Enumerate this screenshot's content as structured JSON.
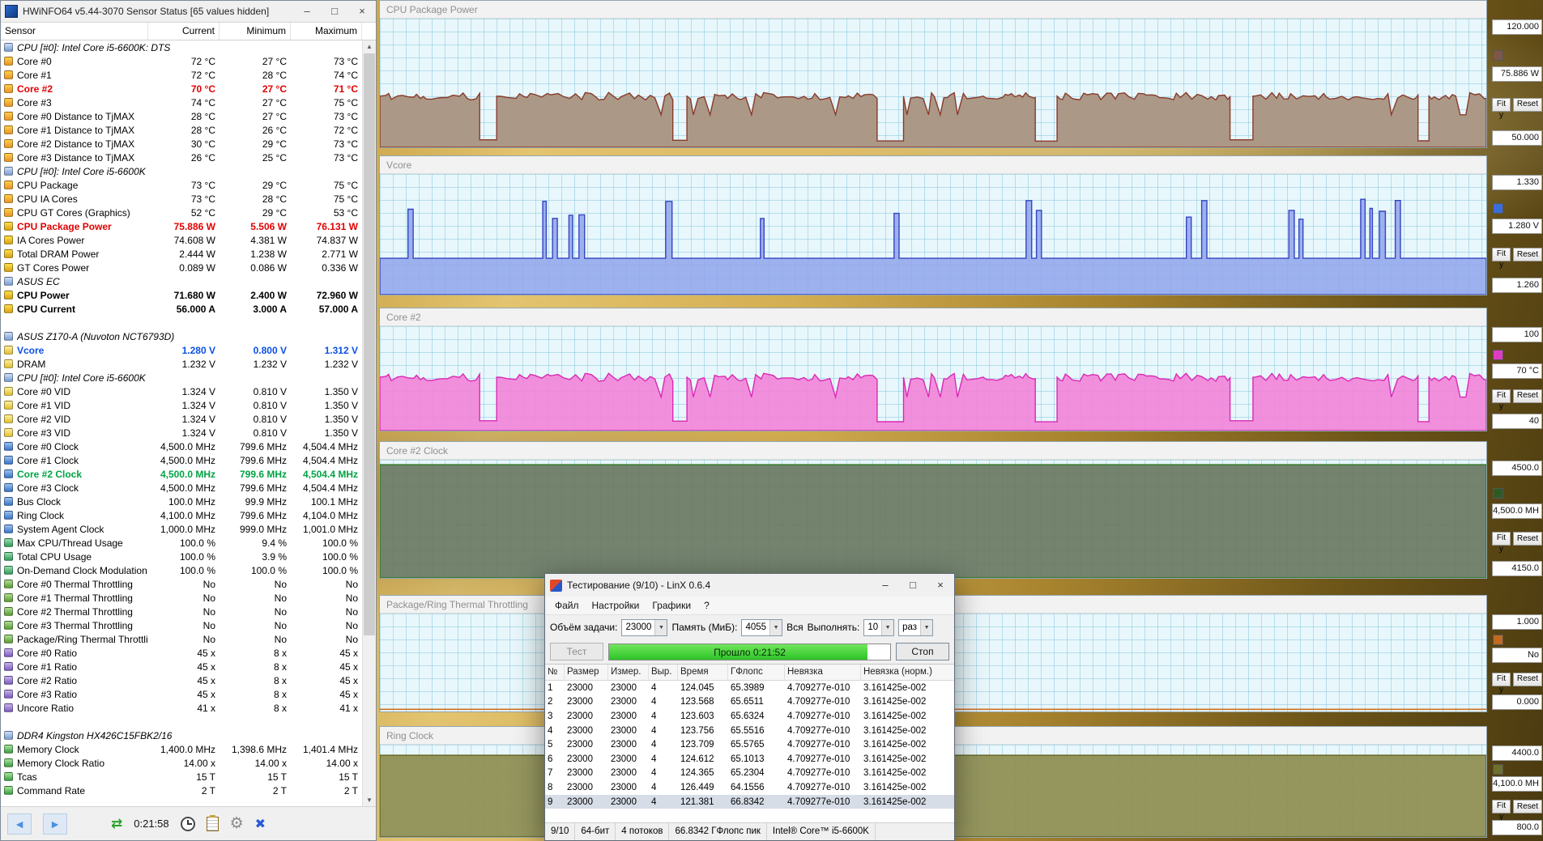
{
  "chrome": {
    "minimize": "–",
    "maximize": "□",
    "close": "×"
  },
  "hwinfo": {
    "title": "HWiNFO64 v5.44-3070 Sensor Status [65 values hidden]",
    "columns": [
      "Sensor",
      "Current",
      "Minimum",
      "Maximum"
    ],
    "toolbar": {
      "time": "0:21:58"
    },
    "rows": [
      {
        "t": "g",
        "l": "CPU [#0]: Intel Core i5-6600K: DTS"
      },
      {
        "t": "v",
        "i": "temp",
        "l": "Core #0",
        "c": "72 °C",
        "m": "27 °C",
        "x": "73 °C"
      },
      {
        "t": "v",
        "i": "temp",
        "l": "Core #1",
        "c": "72 °C",
        "m": "28 °C",
        "x": "74 °C"
      },
      {
        "t": "v",
        "i": "temp",
        "s": "red",
        "l": "Core #2",
        "c": "70 °C",
        "m": "27 °C",
        "x": "71 °C"
      },
      {
        "t": "v",
        "i": "temp",
        "l": "Core #3",
        "c": "74 °C",
        "m": "27 °C",
        "x": "75 °C"
      },
      {
        "t": "v",
        "i": "temp",
        "l": "Core #0 Distance to TjMAX",
        "c": "28 °C",
        "m": "27 °C",
        "x": "73 °C"
      },
      {
        "t": "v",
        "i": "temp",
        "l": "Core #1 Distance to TjMAX",
        "c": "28 °C",
        "m": "26 °C",
        "x": "72 °C"
      },
      {
        "t": "v",
        "i": "temp",
        "l": "Core #2 Distance to TjMAX",
        "c": "30 °C",
        "m": "29 °C",
        "x": "73 °C"
      },
      {
        "t": "v",
        "i": "temp",
        "l": "Core #3 Distance to TjMAX",
        "c": "26 °C",
        "m": "25 °C",
        "x": "73 °C"
      },
      {
        "t": "g",
        "l": "CPU [#0]: Intel Core i5-6600K"
      },
      {
        "t": "v",
        "i": "temp",
        "l": "CPU Package",
        "c": "73 °C",
        "m": "29 °C",
        "x": "75 °C"
      },
      {
        "t": "v",
        "i": "temp",
        "l": "CPU IA Cores",
        "c": "73 °C",
        "m": "28 °C",
        "x": "75 °C"
      },
      {
        "t": "v",
        "i": "temp",
        "l": "CPU GT Cores (Graphics)",
        "c": "52 °C",
        "m": "29 °C",
        "x": "53 °C"
      },
      {
        "t": "v",
        "i": "power",
        "s": "red",
        "l": "CPU Package Power",
        "c": "75.886 W",
        "m": "5.506 W",
        "x": "76.131 W"
      },
      {
        "t": "v",
        "i": "power",
        "l": "IA Cores Power",
        "c": "74.608 W",
        "m": "4.381 W",
        "x": "74.837 W"
      },
      {
        "t": "v",
        "i": "power",
        "l": "Total DRAM Power",
        "c": "2.444 W",
        "m": "1.238 W",
        "x": "2.771 W"
      },
      {
        "t": "v",
        "i": "power",
        "l": "GT Cores Power",
        "c": "0.089 W",
        "m": "0.086 W",
        "x": "0.336 W"
      },
      {
        "t": "g",
        "l": "ASUS EC"
      },
      {
        "t": "v",
        "i": "power",
        "s": "bold",
        "l": "CPU Power",
        "c": "71.680 W",
        "m": "2.400 W",
        "x": "72.960 W"
      },
      {
        "t": "v",
        "i": "power",
        "s": "bold",
        "l": "CPU Current",
        "c": "56.000 A",
        "m": "3.000 A",
        "x": "57.000 A"
      },
      {
        "t": "s"
      },
      {
        "t": "g",
        "l": "ASUS Z170-A (Nuvoton NCT6793D)"
      },
      {
        "t": "v",
        "i": "volt",
        "s": "blue",
        "l": "Vcore",
        "c": "1.280 V",
        "m": "0.800 V",
        "x": "1.312 V"
      },
      {
        "t": "v",
        "i": "volt",
        "l": "DRAM",
        "c": "1.232 V",
        "m": "1.232 V",
        "x": "1.232 V"
      },
      {
        "t": "g",
        "l": "CPU [#0]: Intel Core i5-6600K"
      },
      {
        "t": "v",
        "i": "volt",
        "l": "Core #0 VID",
        "c": "1.324 V",
        "m": "0.810 V",
        "x": "1.350 V"
      },
      {
        "t": "v",
        "i": "volt",
        "l": "Core #1 VID",
        "c": "1.324 V",
        "m": "0.810 V",
        "x": "1.350 V"
      },
      {
        "t": "v",
        "i": "volt",
        "l": "Core #2 VID",
        "c": "1.324 V",
        "m": "0.810 V",
        "x": "1.350 V"
      },
      {
        "t": "v",
        "i": "volt",
        "l": "Core #3 VID",
        "c": "1.324 V",
        "m": "0.810 V",
        "x": "1.350 V"
      },
      {
        "t": "v",
        "i": "clock",
        "l": "Core #0 Clock",
        "c": "4,500.0 MHz",
        "m": "799.6 MHz",
        "x": "4,504.4 MHz"
      },
      {
        "t": "v",
        "i": "clock",
        "l": "Core #1 Clock",
        "c": "4,500.0 MHz",
        "m": "799.6 MHz",
        "x": "4,504.4 MHz"
      },
      {
        "t": "v",
        "i": "clock",
        "s": "green",
        "l": "Core #2 Clock",
        "c": "4,500.0 MHz",
        "m": "799.6 MHz",
        "x": "4,504.4 MHz"
      },
      {
        "t": "v",
        "i": "clock",
        "l": "Core #3 Clock",
        "c": "4,500.0 MHz",
        "m": "799.6 MHz",
        "x": "4,504.4 MHz"
      },
      {
        "t": "v",
        "i": "clock",
        "l": "Bus Clock",
        "c": "100.0 MHz",
        "m": "99.9 MHz",
        "x": "100.1 MHz"
      },
      {
        "t": "v",
        "i": "clock",
        "l": "Ring Clock",
        "c": "4,100.0 MHz",
        "m": "799.6 MHz",
        "x": "4,104.0 MHz"
      },
      {
        "t": "v",
        "i": "clock",
        "l": "System Agent Clock",
        "c": "1,000.0 MHz",
        "m": "999.0 MHz",
        "x": "1,001.0 MHz"
      },
      {
        "t": "v",
        "i": "usage",
        "l": "Max CPU/Thread Usage",
        "c": "100.0 %",
        "m": "9.4 %",
        "x": "100.0 %"
      },
      {
        "t": "v",
        "i": "usage",
        "l": "Total CPU Usage",
        "c": "100.0 %",
        "m": "3.9 %",
        "x": "100.0 %"
      },
      {
        "t": "v",
        "i": "usage",
        "l": "On-Demand Clock Modulation",
        "c": "100.0 %",
        "m": "100.0 %",
        "x": "100.0 %"
      },
      {
        "t": "v",
        "i": "throttle",
        "l": "Core #0 Thermal Throttling",
        "c": "No",
        "m": "No",
        "x": "No"
      },
      {
        "t": "v",
        "i": "throttle",
        "l": "Core #1 Thermal Throttling",
        "c": "No",
        "m": "No",
        "x": "No"
      },
      {
        "t": "v",
        "i": "throttle",
        "l": "Core #2 Thermal Throttling",
        "c": "No",
        "m": "No",
        "x": "No"
      },
      {
        "t": "v",
        "i": "throttle",
        "l": "Core #3 Thermal Throttling",
        "c": "No",
        "m": "No",
        "x": "No"
      },
      {
        "t": "v",
        "i": "throttle",
        "l": "Package/Ring Thermal Throttling",
        "c": "No",
        "m": "No",
        "x": "No"
      },
      {
        "t": "v",
        "i": "ratio",
        "l": "Core #0 Ratio",
        "c": "45 x",
        "m": "8 x",
        "x": "45 x"
      },
      {
        "t": "v",
        "i": "ratio",
        "l": "Core #1 Ratio",
        "c": "45 x",
        "m": "8 x",
        "x": "45 x"
      },
      {
        "t": "v",
        "i": "ratio",
        "l": "Core #2 Ratio",
        "c": "45 x",
        "m": "8 x",
        "x": "45 x"
      },
      {
        "t": "v",
        "i": "ratio",
        "l": "Core #3 Ratio",
        "c": "45 x",
        "m": "8 x",
        "x": "45 x"
      },
      {
        "t": "v",
        "i": "ratio",
        "l": "Uncore Ratio",
        "c": "41 x",
        "m": "8 x",
        "x": "41 x"
      },
      {
        "t": "s"
      },
      {
        "t": "g",
        "l": "DDR4 Kingston HX426C15FBK2/16"
      },
      {
        "t": "v",
        "i": "mem",
        "l": "Memory Clock",
        "c": "1,400.0 MHz",
        "m": "1,398.6 MHz",
        "x": "1,401.4 MHz"
      },
      {
        "t": "v",
        "i": "mem",
        "l": "Memory Clock Ratio",
        "c": "14.00 x",
        "m": "14.00 x",
        "x": "14.00 x"
      },
      {
        "t": "v",
        "i": "mem",
        "l": "Tcas",
        "c": "15 T",
        "m": "15 T",
        "x": "15 T"
      },
      {
        "t": "v",
        "i": "mem",
        "l": "Command Rate",
        "c": "2 T",
        "m": "2 T",
        "x": "2 T"
      }
    ]
  },
  "graphs": [
    {
      "title": "CPU Package Power",
      "top": "120.000",
      "bottom": "50.000",
      "current": "75.886 W",
      "fit": "Fit y",
      "reset": "Reset",
      "swatch": "#7d5846",
      "stroke": "#8a3a2a",
      "fill": "#a9927f",
      "fill_opacity": 0.95,
      "wave": {
        "type": "plateau",
        "high": 0.4,
        "low": 0.035,
        "noise": 0.06,
        "seed": 7
      }
    },
    {
      "title": "Vcore",
      "top": "1.330",
      "bottom": "1.260",
      "current": "1.280 V",
      "fit": "Fit y",
      "reset": "Reset",
      "swatch": "#3b6ed8",
      "stroke": "#3644c2",
      "fill": "#8fa4ec",
      "fill_opacity": 0.85,
      "wave": {
        "type": "spikes",
        "base": 0.3,
        "high": 0.72,
        "seed": 23
      }
    },
    {
      "title": "Core #2",
      "top": "100",
      "bottom": "40",
      "current": "70 °C",
      "fit": "Fit y",
      "reset": "Reset",
      "swatch": "#de3cc4",
      "stroke": "#dc28b4",
      "fill": "#f283d8",
      "fill_opacity": 0.9,
      "wave": {
        "type": "plateau",
        "high": 0.52,
        "low": 0.07,
        "noise": 0.08,
        "seed": 7
      }
    },
    {
      "title": "Core #2 Clock",
      "top": "4500.0",
      "bottom": "4150.0",
      "current": "4,500.0 MH",
      "fit": "Fit y",
      "reset": "Reset",
      "swatch": "#2f5a26",
      "stroke": "#2e7a22",
      "fill": "#66755e",
      "fill_opacity": 0.9,
      "wave": {
        "type": "flat",
        "level": 0.985
      }
    },
    {
      "title": "Package/Ring Thermal Throttling",
      "top": "1.000",
      "bottom": "0.000",
      "current": "No",
      "fit": "Fit y",
      "reset": "Reset",
      "swatch": "#c06a20",
      "stroke": "#cc7024",
      "fill": "none",
      "fill_opacity": 0,
      "wave": {
        "type": "flat",
        "level": 0.006,
        "line_only": true
      }
    },
    {
      "title": "Ring Clock",
      "top": "4400.0",
      "bottom": "800.0",
      "current": "4,100.0 MH",
      "fit": "Fit y",
      "reset": "Reset",
      "swatch": "#6f6f2e",
      "stroke": "#63631f",
      "fill": "#8d8d50",
      "fill_opacity": 0.92,
      "wave": {
        "type": "flat",
        "level": 0.916
      }
    }
  ],
  "linx": {
    "title": "Тестирование (9/10) - LinX 0.6.4",
    "menu": [
      "Файл",
      "Настройки",
      "Графики",
      "?"
    ],
    "controls": {
      "task_label": "Объём задачи:",
      "task_value": "23000",
      "mem_label": "Память (МиБ):",
      "mem_value": "4055",
      "all_label": "Вся",
      "run_label": "Выполнять:",
      "run_value": "10",
      "unit_value": "раз"
    },
    "test_button": "Тест",
    "progress_text": "Прошло 0:21:52",
    "progress_pct": 92,
    "stop_button": "Стоп",
    "table": {
      "columns": [
        "№",
        "Размер",
        "Измер.",
        "Выр.",
        "Время",
        "ГФлопс",
        "Невязка",
        "Невязка (норм.)"
      ],
      "rows": [
        [
          "1",
          "23000",
          "23000",
          "4",
          "124.045",
          "65.3989",
          "4.709277e-010",
          "3.161425e-002"
        ],
        [
          "2",
          "23000",
          "23000",
          "4",
          "123.568",
          "65.6511",
          "4.709277e-010",
          "3.161425e-002"
        ],
        [
          "3",
          "23000",
          "23000",
          "4",
          "123.603",
          "65.6324",
          "4.709277e-010",
          "3.161425e-002"
        ],
        [
          "4",
          "23000",
          "23000",
          "4",
          "123.756",
          "65.5516",
          "4.709277e-010",
          "3.161425e-002"
        ],
        [
          "5",
          "23000",
          "23000",
          "4",
          "123.709",
          "65.5765",
          "4.709277e-010",
          "3.161425e-002"
        ],
        [
          "6",
          "23000",
          "23000",
          "4",
          "124.612",
          "65.1013",
          "4.709277e-010",
          "3.161425e-002"
        ],
        [
          "7",
          "23000",
          "23000",
          "4",
          "124.365",
          "65.2304",
          "4.709277e-010",
          "3.161425e-002"
        ],
        [
          "8",
          "23000",
          "23000",
          "4",
          "126.449",
          "64.1556",
          "4.709277e-010",
          "3.161425e-002"
        ],
        [
          "9",
          "23000",
          "23000",
          "4",
          "121.381",
          "66.8342",
          "4.709277e-010",
          "3.161425e-002"
        ]
      ],
      "selected_row": 9
    },
    "status": [
      "9/10",
      "64-бит",
      "4 потоков",
      "66.8342 ГФлопс пик",
      "Intel® Core™ i5-6600K"
    ]
  }
}
